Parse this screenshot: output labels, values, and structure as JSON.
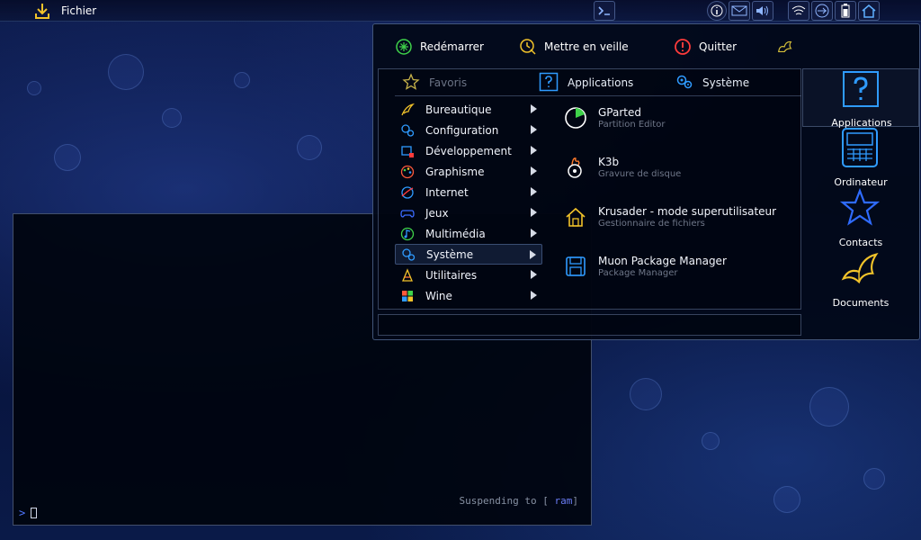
{
  "top_panel": {
    "app_menu_label": "Fichier"
  },
  "terminal": {
    "status_prefix": "Suspending to [ ",
    "status_highlight": "ram",
    "status_suffix": "]",
    "prompt": ">"
  },
  "launcher": {
    "actions": [
      {
        "label": "Redémarrer",
        "icon": "restart-icon"
      },
      {
        "label": "Mettre en veille",
        "icon": "sleep-icon"
      },
      {
        "label": "Quitter",
        "icon": "quit-icon"
      },
      {
        "label": "",
        "icon": "logout-icon"
      }
    ],
    "tabs": [
      {
        "label": "Favoris",
        "icon": "star-icon"
      },
      {
        "label": "Applications",
        "icon": "question-icon"
      },
      {
        "label": "Système",
        "icon": "gears-icon"
      }
    ],
    "categories": [
      {
        "label": "Bureautique",
        "icon": "quill-icon"
      },
      {
        "label": "Configuration",
        "icon": "gears-icon"
      },
      {
        "label": "Développement",
        "icon": "dev-icon"
      },
      {
        "label": "Graphisme",
        "icon": "palette-icon"
      },
      {
        "label": "Internet",
        "icon": "globe-icon"
      },
      {
        "label": "Jeux",
        "icon": "gamepad-icon"
      },
      {
        "label": "Multimédia",
        "icon": "music-icon"
      },
      {
        "label": "Système",
        "icon": "gears-icon"
      },
      {
        "label": "Utilitaires",
        "icon": "cone-icon"
      },
      {
        "label": "Wine",
        "icon": "windows-icon"
      }
    ],
    "apps": [
      {
        "name": "GParted",
        "desc": "Partition Editor",
        "icon": "pie-icon"
      },
      {
        "name": "K3b",
        "desc": "Gravure de disque",
        "icon": "disc-fire-icon"
      },
      {
        "name": "Krusader - mode superutilisateur",
        "desc": "Gestionnaire de fichiers",
        "icon": "house-icon"
      },
      {
        "name": "Muon Package Manager",
        "desc": "Package Manager",
        "icon": "floppy-icon"
      }
    ],
    "places": [
      {
        "label": "Applications",
        "icon": "question-icon"
      },
      {
        "label": "Ordinateur",
        "icon": "computer-icon"
      },
      {
        "label": "Contacts",
        "icon": "star-icon"
      },
      {
        "label": "Documents",
        "icon": "butterfly-icon"
      }
    ]
  },
  "colors": {
    "accent_blue": "#2f9bff",
    "icon_yellow": "#f2c32a",
    "icon_green": "#3fd24a",
    "icon_red": "#ff3b3b"
  }
}
